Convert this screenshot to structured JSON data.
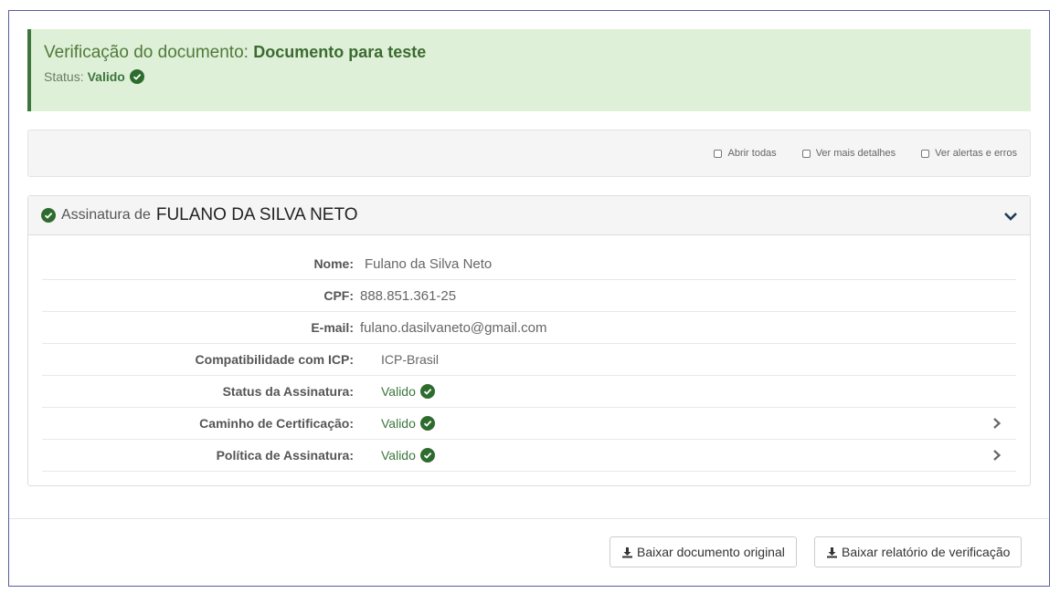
{
  "alert": {
    "title_prefix": "Verificação do documento:",
    "title_doc": "Documento para teste",
    "status_label": "Status:",
    "status_value": "Valido",
    "status_icon": "check-circle-icon"
  },
  "options": [
    {
      "label": "Abrir todas",
      "checked": false
    },
    {
      "label": "Ver mais detalhes",
      "checked": false
    },
    {
      "label": "Ver alertas e erros",
      "checked": false
    }
  ],
  "signature": {
    "header_label": "Assinatura de",
    "signer_name": "FULANO DA SILVA NETO",
    "rows": [
      {
        "label": "Nome:",
        "value": "Fulano da Silva Neto"
      },
      {
        "label": "CPF:",
        "value": "888.851.361-25"
      },
      {
        "label": "E-mail:",
        "value": "fulano.dasilvaneto@gmail.com"
      },
      {
        "label": "Compatibilidade com ICP:",
        "value": "ICP-Brasil"
      },
      {
        "label": "Status da Assinatura:",
        "value": "Valido"
      },
      {
        "label": "Caminho de Certificação:",
        "value": "Valido"
      },
      {
        "label": "Política de Assinatura:",
        "value": "Valido"
      }
    ]
  },
  "buttons": {
    "download_original": "Baixar documento original",
    "download_report": "Baixar relatório de verificação"
  },
  "colors": {
    "success_bg": "#dff0d8",
    "success_text": "#3c763d",
    "check_icon": "#2e6b2e"
  }
}
